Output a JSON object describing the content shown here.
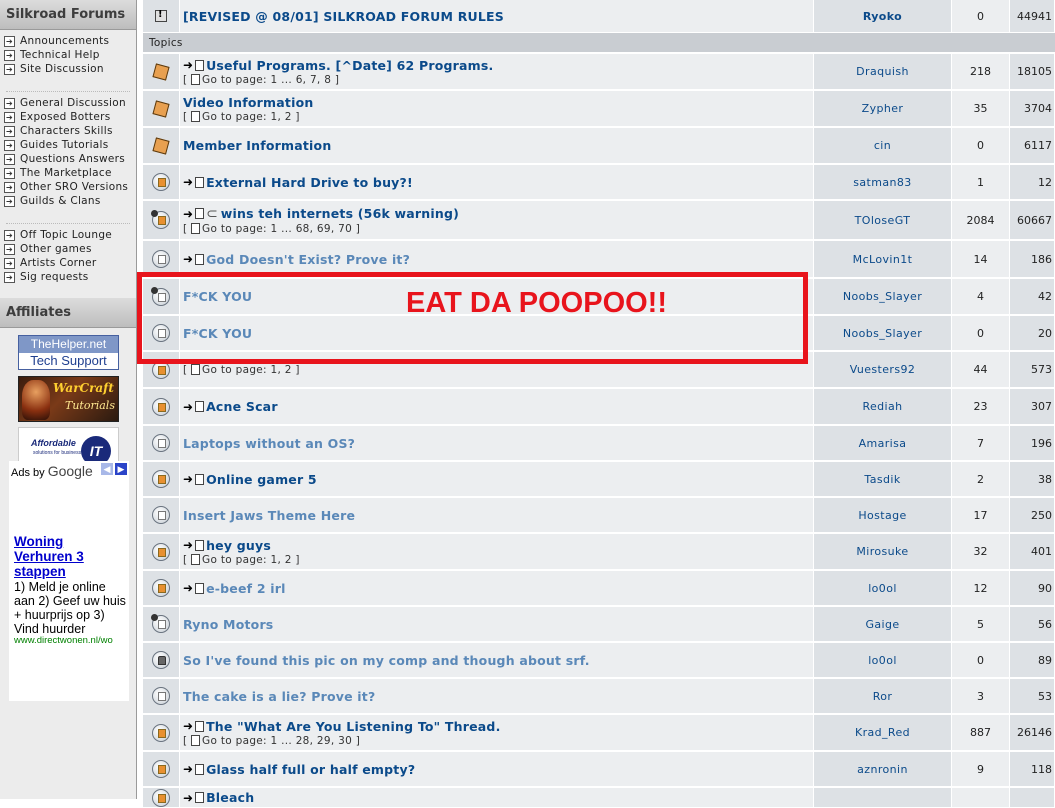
{
  "sidebar": {
    "title": "Silkroad Forums",
    "groups": [
      [
        "Announcements",
        "Technical Help",
        "Site Discussion"
      ],
      [
        "General Discussion",
        "Exposed Botters",
        "Characters Skills",
        "Guides Tutorials",
        "Questions Answers",
        "The Marketplace",
        "Other SRO Versions",
        "Guilds & Clans"
      ],
      [
        "Off Topic Lounge",
        "Other games",
        "Artists Corner",
        "Sig requests"
      ]
    ],
    "affiliates_title": "Affiliates",
    "helper_top": "TheHelper.net",
    "helper_bottom": "Tech Support",
    "warcraft": "WarCraft",
    "tutorials": "Tutorials",
    "affordable": "Affordable",
    "affordable_sub": "solutions for business",
    "it_logo": "IT",
    "ads": {
      "by": "Ads by ",
      "google": "Google",
      "title": "Woning Verhuren 3 stappen",
      "text": "1) Meld je online aan 2) Geef uw huis + huurprijs op 3) Vind huurder",
      "url": "www.directwonen.nl/wo"
    }
  },
  "forum": {
    "announcement": {
      "title": "[REVISED @ 08/01] SILKROAD FORUM RULES",
      "author": "Ryoko",
      "replies": "0",
      "views": "44941"
    },
    "section_label": "Topics",
    "topics": [
      {
        "title": "Useful Programs. [^Date] 62 Programs.",
        "pages": "Go to page: 1 ... 6, 7, 8",
        "author": "Draquish",
        "replies": "218",
        "views": "18105"
      },
      {
        "title": "Video Information",
        "pages": "Go to page: 1, 2",
        "author": "Zypher",
        "replies": "35",
        "views": "3704"
      },
      {
        "title": "Member Information",
        "pages": "",
        "author": "cin",
        "replies": "0",
        "views": "6117"
      },
      {
        "title": "External Hard Drive to buy?!",
        "pages": "",
        "author": "satman83",
        "replies": "1",
        "views": "12"
      },
      {
        "title": "wins teh internets (56k warning)",
        "pages": "Go to page: 1 ... 68, 69, 70",
        "author": "TOloseGT",
        "replies": "2084",
        "views": "60667"
      },
      {
        "title": "God Doesn't Exist? Prove it?",
        "pages": "",
        "author": "McLovin1t",
        "replies": "14",
        "views": "186"
      },
      {
        "title": "F*CK YOU",
        "pages": "",
        "author": "Noobs_Slayer",
        "replies": "4",
        "views": "42"
      },
      {
        "title": "F*CK YOU",
        "pages": "",
        "author": "Noobs_Slayer",
        "replies": "0",
        "views": "20"
      },
      {
        "title": "",
        "pages": "Go to page: 1, 2",
        "author": "Vuesters92",
        "replies": "44",
        "views": "573"
      },
      {
        "title": "Acne Scar",
        "pages": "",
        "author": "Rediah",
        "replies": "23",
        "views": "307"
      },
      {
        "title": "Laptops without an OS?",
        "pages": "",
        "author": "Amarisa",
        "replies": "7",
        "views": "196"
      },
      {
        "title": "Online gamer 5",
        "pages": "",
        "author": "Tasdik",
        "replies": "2",
        "views": "38"
      },
      {
        "title": "Insert Jaws Theme Here",
        "pages": "",
        "author": "Hostage",
        "replies": "17",
        "views": "250"
      },
      {
        "title": "hey guys",
        "pages": "Go to page: 1, 2",
        "author": "Mirosuke",
        "replies": "32",
        "views": "401"
      },
      {
        "title": "e-beef 2 irl",
        "pages": "",
        "author": "lo0ol",
        "replies": "12",
        "views": "90"
      },
      {
        "title": "Ryno Motors",
        "pages": "",
        "author": "Gaige",
        "replies": "5",
        "views": "56"
      },
      {
        "title": "So I've found this pic on my comp and though about srf.",
        "pages": "",
        "author": "lo0ol",
        "replies": "0",
        "views": "89"
      },
      {
        "title": "The cake is a lie? Prove it?",
        "pages": "",
        "author": "Ror",
        "replies": "3",
        "views": "53"
      },
      {
        "title": "The \"What Are You Listening To\" Thread.",
        "pages": "Go to page: 1 ... 28, 29, 30",
        "author": "Krad_Red",
        "replies": "887",
        "views": "26146"
      },
      {
        "title": "Glass half full or half empty?",
        "pages": "",
        "author": "aznronin",
        "replies": "9",
        "views": "118"
      },
      {
        "title": "Bleach",
        "pages": "",
        "author": "",
        "replies": "",
        "views": ""
      }
    ]
  },
  "overlay": {
    "text": "EAT DA POOPOO!!",
    "color": "#e8141c"
  }
}
